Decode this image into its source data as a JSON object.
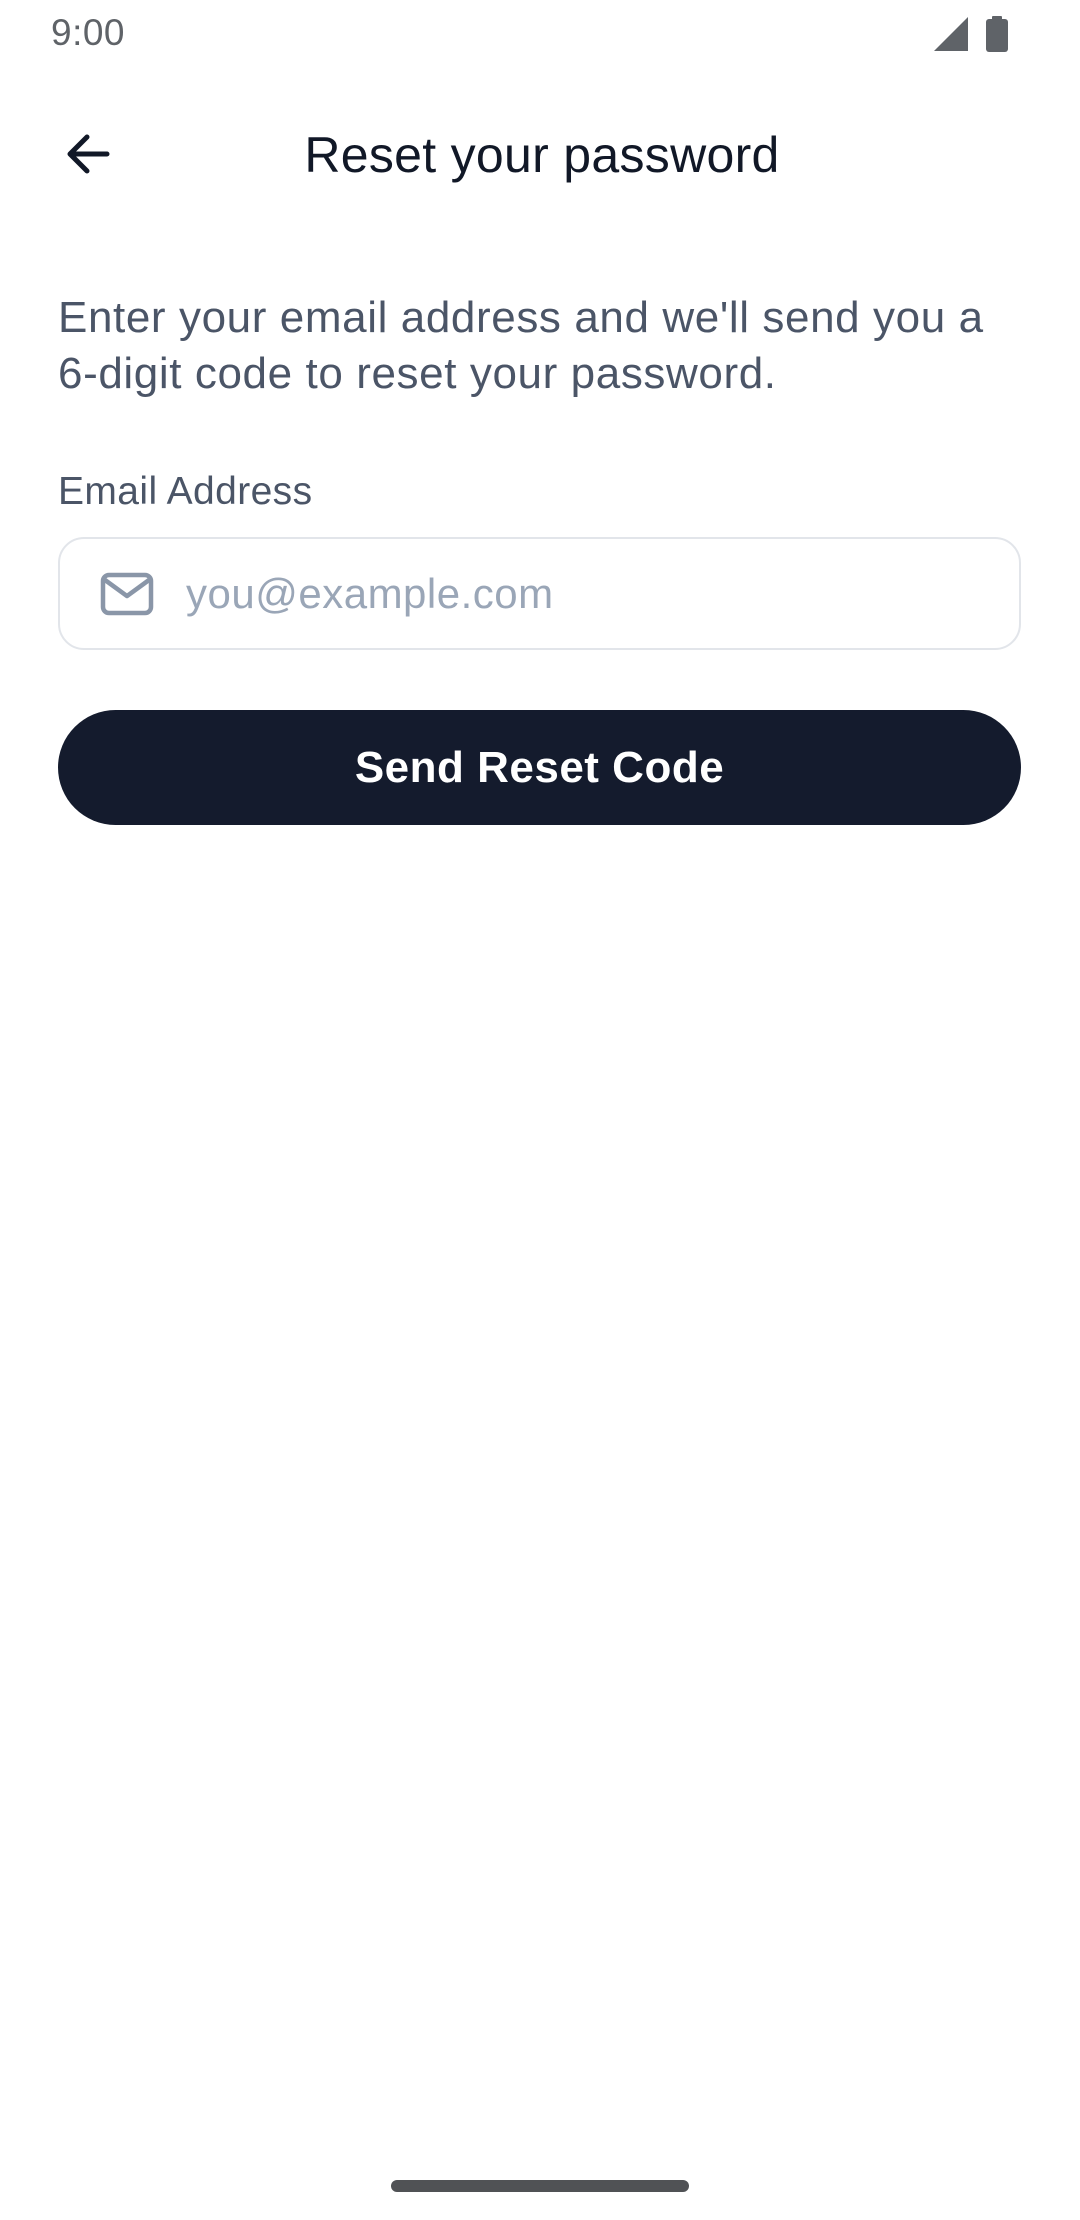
{
  "status_bar": {
    "time": "9:00",
    "signal_icon": "signal-icon",
    "battery_icon": "battery-icon"
  },
  "header": {
    "back_icon": "arrow-left-icon",
    "title": "Reset your password"
  },
  "main": {
    "description": "Enter your email address and we'll send you a 6-digit code to reset your password.",
    "email_label": "Email Address",
    "email_icon": "mail-icon",
    "email_placeholder": "you@example.com",
    "email_value": "",
    "submit_label": "Send Reset Code"
  },
  "colors": {
    "primary_button": "#141b2d",
    "placeholder": "#9aa6b7",
    "body_text": "#4b5567",
    "title_text": "#111827",
    "field_border": "#e2e5ea"
  }
}
